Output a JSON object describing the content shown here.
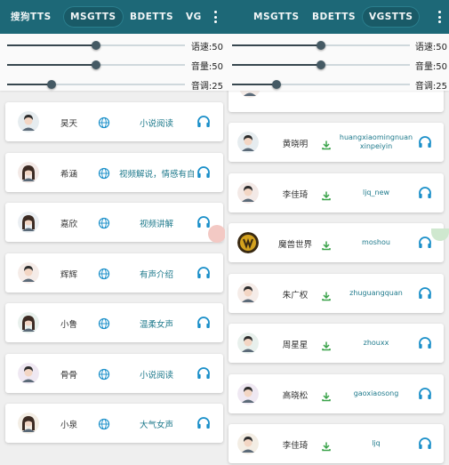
{
  "left": {
    "tabs": [
      "搜狗TTS",
      "MSGTTS",
      "BDETTS",
      "VG"
    ],
    "active_tab": 1,
    "sliders": [
      {
        "label": "语速:50",
        "value": 50
      },
      {
        "label": "音量:50",
        "value": 50
      },
      {
        "label": "音调:25",
        "value": 25
      }
    ],
    "voices": [
      {
        "name": "昊天",
        "desc": "小说阅读",
        "avatar": "male-avatar"
      },
      {
        "name": "希涵",
        "desc": "视频解说，情感有自",
        "avatar": "female-avatar"
      },
      {
        "name": "嘉欣",
        "desc": "视频讲解",
        "avatar": "female-avatar"
      },
      {
        "name": "辉辉",
        "desc": "有声介绍",
        "avatar": "male-avatar"
      },
      {
        "name": "小鲁",
        "desc": "温柔女声",
        "avatar": "female-avatar"
      },
      {
        "name": "骨骨",
        "desc": "小说阅读",
        "avatar": "male-avatar"
      },
      {
        "name": "小泉",
        "desc": "大气女声",
        "avatar": "female-avatar"
      }
    ]
  },
  "right": {
    "tabs": [
      "MSGTTS",
      "BDETTS",
      "VGSTTS"
    ],
    "active_tab": 2,
    "sliders": [
      {
        "label": "语速:50",
        "value": 50
      },
      {
        "label": "音量:50",
        "value": 50
      },
      {
        "label": "音调:25",
        "value": 25
      }
    ],
    "voices": [
      {
        "name": "黄晓明",
        "id": "huangxiaomingnuanxinpeiyin",
        "avatar": "male-avatar"
      },
      {
        "name": "李佳琦",
        "id": "ljq_new",
        "avatar": "male-avatar"
      },
      {
        "name": "魔兽世界",
        "id": "moshou",
        "avatar": "warcraft-logo"
      },
      {
        "name": "朱广权",
        "id": "zhuguangquan",
        "avatar": "male-avatar"
      },
      {
        "name": "周星星",
        "id": "zhouxx",
        "avatar": "male-avatar"
      },
      {
        "name": "高晓松",
        "id": "gaoxiaosong",
        "avatar": "male-avatar"
      },
      {
        "name": "李佳琦",
        "id": "ljq",
        "avatar": "male-avatar"
      }
    ]
  },
  "colors": {
    "header": "#1d6877",
    "accent": "#1f7a8c",
    "icon_blue": "#1a8fc9",
    "download_green": "#3aa34a"
  }
}
